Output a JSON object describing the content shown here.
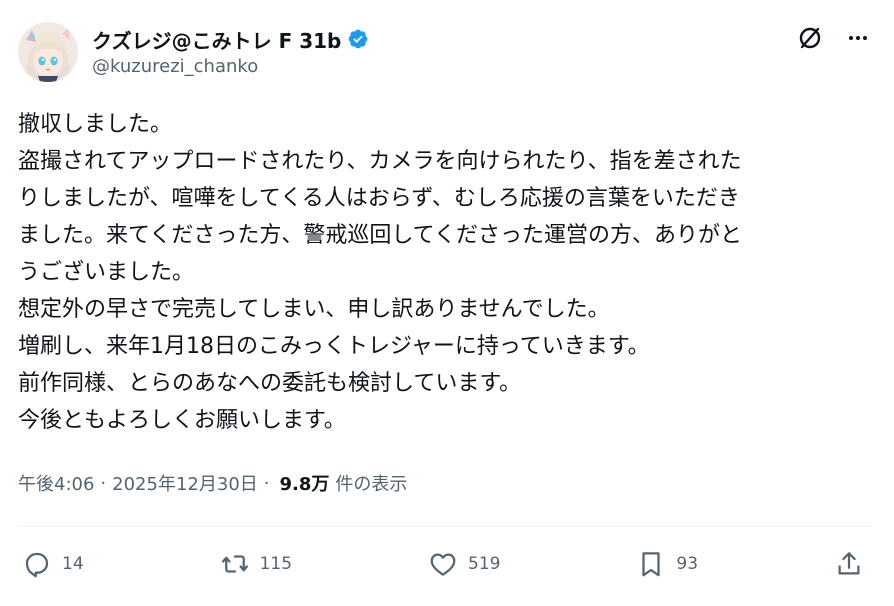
{
  "author": {
    "display_name": "クズレジ@こみトレ F 31b",
    "handle": "@kuzurezi_chanko",
    "avatar_icon": "avatar-anime-girl",
    "verified_color": "#1d9bf0"
  },
  "header": {
    "icons": [
      "grok-icon",
      "more-icon"
    ]
  },
  "post": {
    "lines": [
      "撤収しました。",
      "盗撮されてアップロードされたり、カメラを向けられたり、指を差された",
      "りしましたが、喧嘩をしてくる人はおらず、むしろ応援の言葉をいただき",
      "ました。来てくださった方、警戒巡回してくださった運営の方、ありがと",
      "うございました。",
      "想定外の早さで完売してしまい、申し訳ありませんでした。",
      "増刷し、来年1月18日のこみっくトレジャーに持っていきます。",
      "前作同様、とらのあなへの委託も検討しています。",
      "今後ともよろしくお願いします。"
    ]
  },
  "meta": {
    "time": "午後4:06",
    "separator": "·",
    "date": "2025年12月30日",
    "views_count": "9.8万",
    "views_label": "件の表示"
  },
  "actions": {
    "replies": "14",
    "reposts": "115",
    "likes": "519",
    "bookmarks": "93"
  },
  "colors": {
    "text": "#0f1419",
    "muted": "#536471",
    "divider": "#eff3f4",
    "verified": "#1d9bf0"
  }
}
